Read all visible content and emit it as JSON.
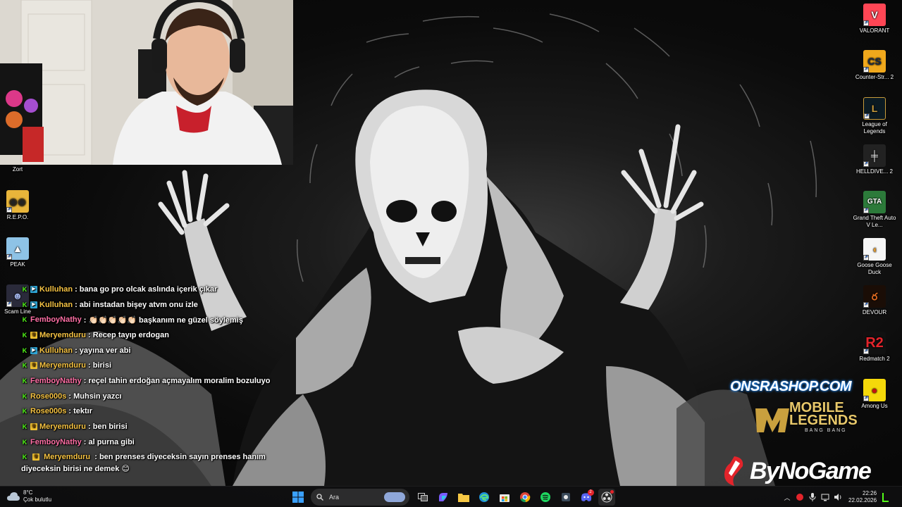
{
  "desktop_icons_right": [
    {
      "label": "VALORANT",
      "icon": "valorant-icon",
      "color": "#ff4655"
    },
    {
      "label": "Counter-Str... 2",
      "icon": "counter-strike-icon",
      "color": "#f0a81c"
    },
    {
      "label": "League of Legends",
      "icon": "league-of-legends-icon",
      "color": "#c89b3c"
    },
    {
      "label": "HELLDIVE... 2",
      "icon": "helldivers-icon",
      "color": "#e8e8e8"
    },
    {
      "label": "Grand Theft Auto V Le...",
      "icon": "gta-icon",
      "color": "#2c7a3a"
    },
    {
      "label": "Goose Goose Duck",
      "icon": "goose-goose-duck-icon",
      "color": "#f6f6f6"
    },
    {
      "label": "DEVOUR",
      "icon": "devour-icon",
      "color": "#e26a1f"
    },
    {
      "label": "Redmatch 2",
      "icon": "redmatch-icon",
      "color": "#e3242b"
    },
    {
      "label": "Among Us",
      "icon": "among-us-icon",
      "color": "#f5d90a"
    }
  ],
  "desktop_icons_left": [
    {
      "label": "Zort",
      "icon": "zort-icon"
    },
    {
      "label": "R.E.P.O.",
      "icon": "repo-icon",
      "color": "#e8b53a"
    },
    {
      "label": "PEAK",
      "icon": "peak-icon",
      "color": "#8ec3e6"
    },
    {
      "label": "Scam Line",
      "icon": "scam-line-icon",
      "color": "#2a2a3a"
    }
  ],
  "chat": {
    "messages": [
      {
        "user": "Kulluhan",
        "color": "#f6c343",
        "badges": [
          "kick",
          "vip"
        ],
        "text": ": bana go pro olcak aslında içerik çıkar"
      },
      {
        "user": "Kulluhan",
        "color": "#f6c343",
        "badges": [
          "kick",
          "vip"
        ],
        "text": ": abi instadan bişey atvm onu izle"
      },
      {
        "user": "FemboyNathy",
        "color": "#ff6fa5",
        "badges": [
          "kick"
        ],
        "text": ": 👏🏻👏🏻👏🏻👏🏻👏🏻 başkanım ne güzel söylemiş"
      },
      {
        "user": "Meryemduru",
        "color": "#f6c343",
        "badges": [
          "kick",
          "crown"
        ],
        "text": ": Recep tayıp erdogan"
      },
      {
        "user": "Kulluhan",
        "color": "#f6c343",
        "badges": [
          "kick",
          "vip"
        ],
        "text": ": yayına ver abi"
      },
      {
        "user": "Meryemduru",
        "color": "#f6c343",
        "badges": [
          "kick",
          "crown"
        ],
        "text": ": birisi"
      },
      {
        "user": "FemboyNathy",
        "color": "#ff6fa5",
        "badges": [
          "kick"
        ],
        "text": ": reçel tahin erdoğan açmayalım moralim bozuluyo"
      },
      {
        "user": "Rose000s",
        "color": "#f6c343",
        "badges": [
          "kick"
        ],
        "text": ": Muhsin yazcı"
      },
      {
        "user": "Rose000s",
        "color": "#f6c343",
        "badges": [
          "kick"
        ],
        "text": ": tektır"
      },
      {
        "user": "Meryemduru",
        "color": "#f6c343",
        "badges": [
          "kick",
          "crown"
        ],
        "text": ": ben birisi"
      },
      {
        "user": "FemboyNathy",
        "color": "#ff6fa5",
        "badges": [
          "kick"
        ],
        "text": ": al purna gibi"
      },
      {
        "user": "Meryemduru",
        "color": "#f6c343",
        "badges": [
          "kick",
          "crown"
        ],
        "text": ": ben prenses diyeceksin sayın prenses hanım diyeceksin birisi ne demek 😊"
      }
    ]
  },
  "sponsors": {
    "onsra": "ONSRASHOP.COM",
    "mlbb_line1": "MOBILE",
    "mlbb_line2": "LEGENDS",
    "mlbb_line3": "BANG BANG",
    "bynogame": "ByNoGame"
  },
  "taskbar": {
    "weather_temp": "8°C",
    "weather_desc": "Çok bulutlu",
    "search_placeholder": "Ara",
    "time": "22:26",
    "date": "22.02.2026",
    "discord_badge": "2"
  },
  "colors": {
    "kick_green": "#53fc18",
    "accent_blue": "#1e8bff"
  }
}
